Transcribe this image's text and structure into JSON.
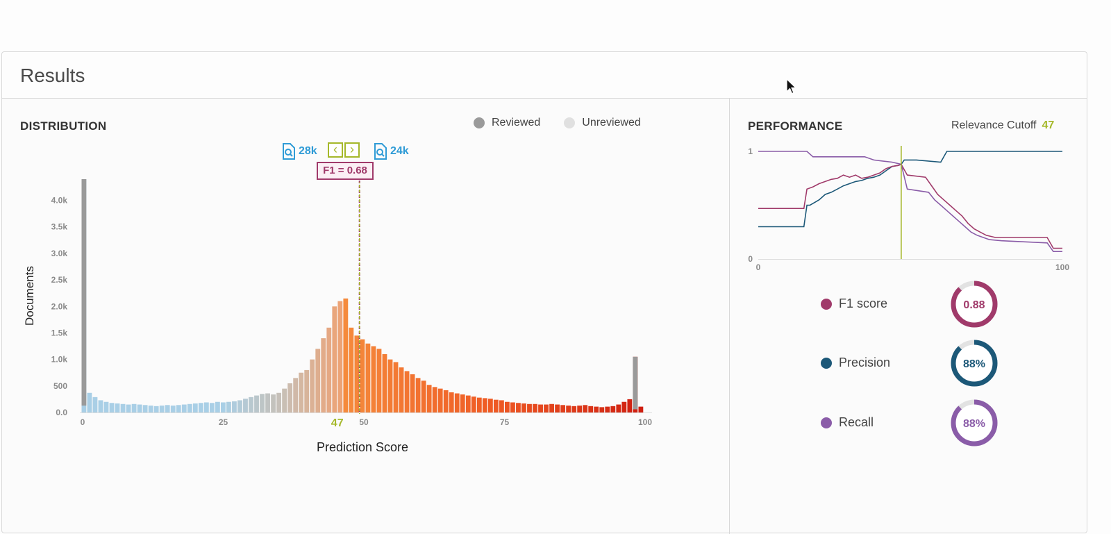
{
  "header": {
    "title": "Results"
  },
  "distribution": {
    "title": "DISTRIBUTION",
    "legend": {
      "reviewed": "Reviewed",
      "unreviewed": "Unreviewed",
      "reviewed_color": "#9a9a9a",
      "unreviewed_color": "#e0e0e0"
    },
    "left_count": "28k",
    "right_count": "24k",
    "f1_label": "F1 = 0.68",
    "cutoff_value": "47"
  },
  "performance": {
    "title": "PERFORMANCE",
    "cutoff_label": "Relevance Cutoff",
    "cutoff_value": "47",
    "metrics": [
      {
        "label": "F1 score",
        "value": "0.88",
        "fraction": 0.88,
        "color": "#a03a6a"
      },
      {
        "label": "Precision",
        "value": "88%",
        "fraction": 0.88,
        "color": "#1c5878"
      },
      {
        "label": "Recall",
        "value": "88%",
        "fraction": 0.88,
        "color": "#8a5ca8"
      }
    ]
  },
  "chart_data": [
    {
      "type": "bar",
      "xlabel": "Prediction Score",
      "ylabel": "Documents",
      "xlim": [
        0,
        100
      ],
      "ylim": [
        0,
        4400
      ],
      "x_ticks": [
        "0",
        "25",
        "47",
        "50",
        "75",
        "100"
      ],
      "y_ticks": [
        "0.0",
        "500",
        "1.0k",
        "1.5k",
        "2.0k",
        "2.5k",
        "3.0k",
        "3.5k",
        "4.0k"
      ],
      "cutoff": 47,
      "x": [
        0,
        1,
        2,
        3,
        4,
        5,
        6,
        7,
        8,
        9,
        10,
        11,
        12,
        13,
        14,
        15,
        16,
        17,
        18,
        19,
        20,
        21,
        22,
        23,
        24,
        25,
        26,
        27,
        28,
        29,
        30,
        31,
        32,
        33,
        34,
        35,
        36,
        37,
        38,
        39,
        40,
        41,
        42,
        43,
        44,
        45,
        46,
        47,
        48,
        49,
        50,
        51,
        52,
        53,
        54,
        55,
        56,
        57,
        58,
        59,
        60,
        61,
        62,
        63,
        64,
        65,
        66,
        67,
        68,
        69,
        70,
        71,
        72,
        73,
        74,
        75,
        76,
        77,
        78,
        79,
        80,
        81,
        82,
        83,
        84,
        85,
        86,
        87,
        88,
        89,
        90,
        91,
        92,
        93,
        94,
        95,
        96,
        97,
        98,
        99,
        100
      ],
      "values": [
        4400,
        370,
        290,
        230,
        200,
        180,
        170,
        160,
        150,
        160,
        150,
        140,
        130,
        120,
        130,
        140,
        130,
        140,
        150,
        160,
        170,
        180,
        190,
        180,
        200,
        190,
        200,
        210,
        230,
        260,
        290,
        320,
        350,
        360,
        340,
        370,
        450,
        550,
        650,
        750,
        800,
        1000,
        1200,
        1400,
        1600,
        2000,
        2100,
        2150,
        1600,
        1450,
        1380,
        1300,
        1250,
        1200,
        1100,
        1000,
        950,
        850,
        780,
        720,
        650,
        600,
        520,
        480,
        450,
        420,
        380,
        360,
        340,
        320,
        300,
        280,
        270,
        260,
        240,
        230,
        200,
        190,
        180,
        170,
        160,
        160,
        150,
        150,
        160,
        150,
        140,
        130,
        120,
        130,
        140,
        120,
        110,
        100,
        110,
        120,
        150,
        200,
        250,
        1050,
        110
      ],
      "reviewed": [
        {
          "x": 0,
          "value": 130
        },
        {
          "x": 99,
          "value": 60
        }
      ]
    },
    {
      "type": "line",
      "xlim": [
        0,
        100
      ],
      "ylim": [
        0,
        1
      ],
      "x_ticks": [
        "0",
        "100"
      ],
      "y_ticks": [
        "0",
        "1"
      ],
      "cutoff": 47,
      "series": [
        {
          "color": "#1c5878",
          "x": [
            0,
            15,
            16,
            17,
            20,
            22,
            24,
            26,
            28,
            30,
            32,
            34,
            36,
            38,
            40,
            42,
            44,
            46,
            47,
            48,
            52,
            60,
            62,
            100
          ],
          "y": [
            0.3,
            0.3,
            0.5,
            0.5,
            0.55,
            0.6,
            0.62,
            0.65,
            0.68,
            0.7,
            0.72,
            0.73,
            0.75,
            0.76,
            0.78,
            0.82,
            0.86,
            0.87,
            0.88,
            0.92,
            0.92,
            0.9,
            1.0,
            1.0
          ]
        },
        {
          "color": "#a03a6a",
          "x": [
            0,
            15,
            16,
            18,
            20,
            22,
            24,
            26,
            28,
            30,
            32,
            34,
            36,
            38,
            40,
            42,
            44,
            46,
            47,
            49,
            55,
            57,
            59,
            61,
            63,
            65,
            67,
            69,
            71,
            73,
            75,
            78,
            80,
            95,
            97,
            100
          ],
          "y": [
            0.47,
            0.47,
            0.65,
            0.67,
            0.7,
            0.72,
            0.74,
            0.75,
            0.78,
            0.76,
            0.78,
            0.75,
            0.76,
            0.78,
            0.8,
            0.84,
            0.86,
            0.87,
            0.88,
            0.78,
            0.76,
            0.68,
            0.6,
            0.55,
            0.5,
            0.45,
            0.4,
            0.33,
            0.28,
            0.25,
            0.22,
            0.2,
            0.2,
            0.2,
            0.1,
            0.1
          ]
        },
        {
          "color": "#8a5ca8",
          "x": [
            0,
            16,
            18,
            35,
            38,
            44,
            47,
            49,
            56,
            58,
            60,
            62,
            64,
            66,
            68,
            70,
            72,
            74,
            76,
            80,
            95,
            97,
            100
          ],
          "y": [
            1.0,
            1.0,
            0.95,
            0.95,
            0.92,
            0.9,
            0.88,
            0.65,
            0.62,
            0.55,
            0.5,
            0.45,
            0.4,
            0.35,
            0.3,
            0.25,
            0.22,
            0.2,
            0.18,
            0.17,
            0.15,
            0.07,
            0.07
          ]
        }
      ]
    }
  ]
}
